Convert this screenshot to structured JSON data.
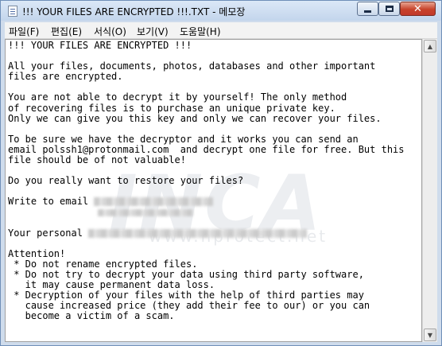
{
  "window": {
    "title": "!!! YOUR FILES ARE ENCRYPTED !!!.TXT - 메모장",
    "close_glyph": "✕"
  },
  "menu": {
    "file": "파일(F)",
    "edit": "편집(E)",
    "format": "서식(O)",
    "view": "보기(V)",
    "help": "도움말(H)"
  },
  "document": {
    "line_01": "!!! YOUR FILES ARE ENCRYPTED !!!",
    "line_02": "",
    "line_03": "All your files, documents, photos, databases and other important",
    "line_04": "files are encrypted.",
    "line_05": "",
    "line_06": "You are not able to decrypt it by yourself! The only method",
    "line_07": "of recovering files is to purchase an unique private key.",
    "line_08": "Only we can give you this key and only we can recover your files.",
    "line_09": "",
    "line_10": "To be sure we have the decryptor and it works you can send an",
    "line_11": "email polssh1@protonmail.com  and decrypt one file for free. But this",
    "line_12": "file should be of not valuable!",
    "line_13": "",
    "line_14": "Do you really want to restore your files?",
    "line_15": "",
    "line_16_prefix": "Write to email ",
    "line_17": "",
    "line_18": "",
    "line_19_prefix": "Your personal ",
    "line_20": "",
    "line_21": "Attention!",
    "line_22": " * Do not rename encrypted files.",
    "line_23": " * Do not try to decrypt your data using third party software,",
    "line_24": "   it may cause permanent data loss.",
    "line_25": " * Decryption of your files with the help of third parties may",
    "line_26": "   cause increased price (they add their fee to our) or you can",
    "line_27": "   become a victim of a scam."
  },
  "watermark": {
    "main": "INCA",
    "sub": "www.nprotect.net"
  },
  "scrollbar": {
    "up_glyph": "▲",
    "down_glyph": "▼"
  }
}
